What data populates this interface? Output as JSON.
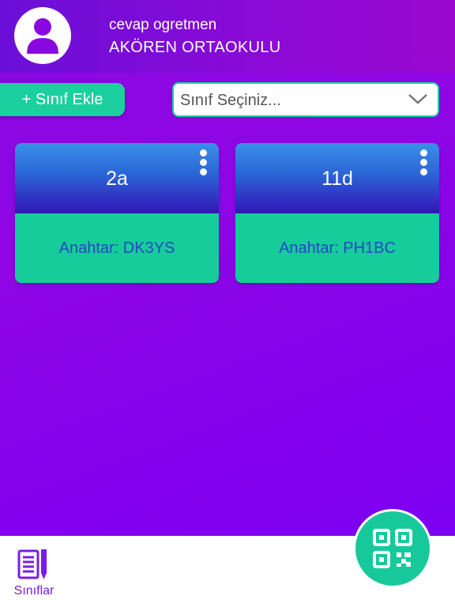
{
  "header": {
    "user_name": "cevap ogretmen",
    "school_name": "AKÖREN ORTAOKULU"
  },
  "toolbar": {
    "add_class_label": "+ Sınıf Ekle",
    "class_select": {
      "placeholder": "Sınıf Seçiniz..."
    }
  },
  "classes": [
    {
      "name": "2a",
      "key_label": "Anahtar: DK3YS"
    },
    {
      "name": "11d",
      "key_label": "Anahtar: PH1BC"
    }
  ],
  "bottom_nav": {
    "classes_label": "Sınıflar"
  },
  "icons": {
    "avatar": "user-icon",
    "select": "chevron-down-icon",
    "card_menu": "kebab-menu-icon",
    "nav": "notebook-pencil-icon",
    "fab": "qr-code-icon"
  },
  "colors": {
    "accent": "#1ccf9f",
    "primary": "#8a08e0",
    "card_top": "#2a64d6",
    "key_text": "#2a45c8"
  }
}
